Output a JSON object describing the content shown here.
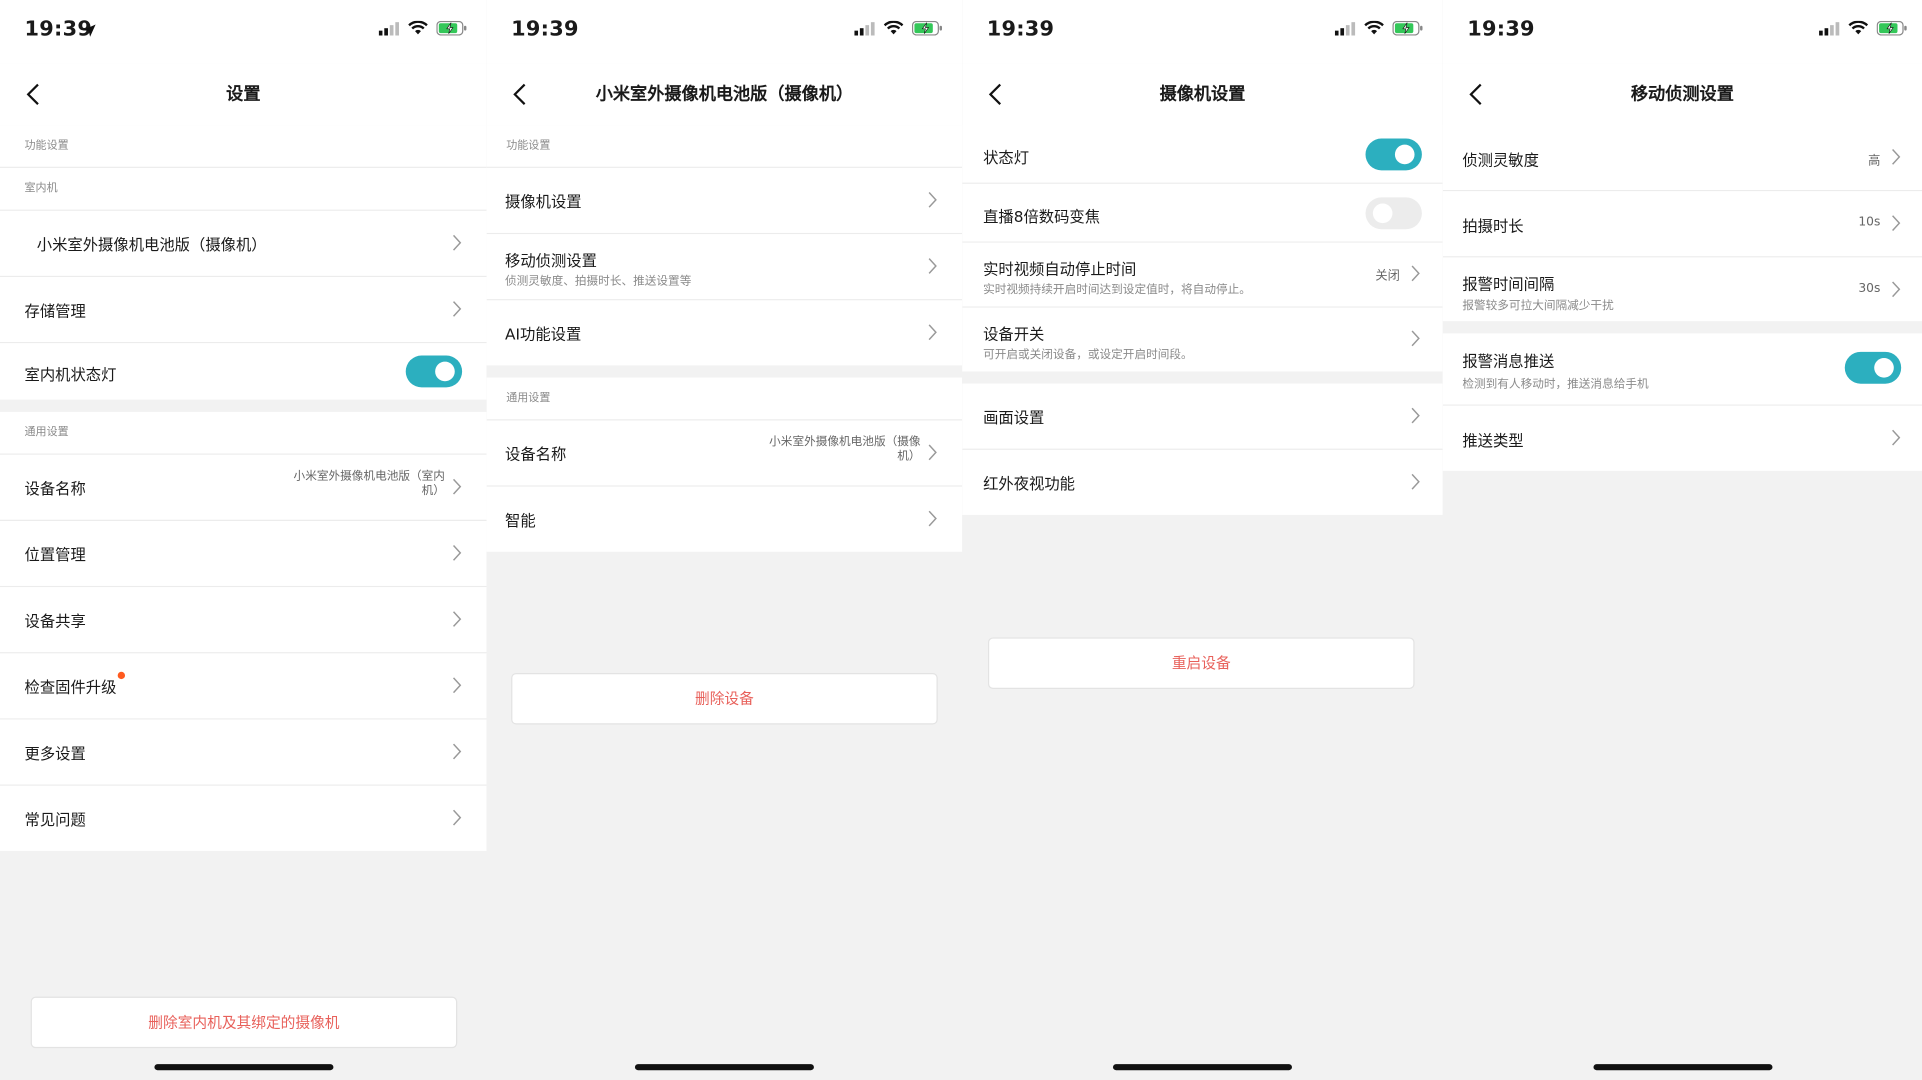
{
  "status": {
    "time": "19:39"
  },
  "screen1": {
    "title": "设置",
    "section_function": "功能设置",
    "section_indoor": "室内机",
    "camera_item": "小米室外摄像机电池版（摄像机）",
    "storage": "存储管理",
    "indoor_light": "室内机状态灯",
    "section_general": "通用设置",
    "device_name": "设备名称",
    "device_name_value_1": "小米室外摄像机电池版（室内",
    "device_name_value_2": "机）",
    "location": "位置管理",
    "share": "设备共享",
    "firmware": "检查固件升级",
    "more": "更多设置",
    "faq": "常见问题",
    "delete_button": "删除室内机及其绑定的摄像机"
  },
  "screen2": {
    "title": "小米室外摄像机电池版（摄像机）",
    "section_function": "功能设置",
    "camera_settings": "摄像机设置",
    "motion": "移动侦测设置",
    "motion_sub": "侦测灵敏度、拍摄时长、推送设置等",
    "ai": "AI功能设置",
    "section_general": "通用设置",
    "device_name": "设备名称",
    "device_name_value_1": "小米室外摄像机电池版（摄像",
    "device_name_value_2": "机）",
    "smart": "智能",
    "delete_button": "删除设备"
  },
  "screen3": {
    "title": "摄像机设置",
    "status_light": "状态灯",
    "zoom": "直播8倍数码变焦",
    "auto_stop": "实时视频自动停止时间",
    "auto_stop_sub": "实时视频持续开启时间达到设定值时，将自动停止。",
    "auto_stop_value": "关闭",
    "power": "设备开关",
    "power_sub": "可开启或关闭设备，或设定开启时间段。",
    "image": "画面设置",
    "night": "红外夜视功能",
    "restart_button": "重启设备"
  },
  "screen4": {
    "title": "移动侦测设置",
    "sensitivity": "侦测灵敏度",
    "sensitivity_value": "高",
    "duration": "拍摄时长",
    "duration_value": "10s",
    "interval": "报警时间间隔",
    "interval_sub": "报警较多可拉大间隔减少干扰",
    "interval_value": "30s",
    "push": "报警消息推送",
    "push_sub": "检测到有人移动时，推送消息给手机",
    "push_type": "推送类型"
  },
  "toggles": {
    "indoor_light": true,
    "status_light": true,
    "zoom": false,
    "push": true
  },
  "colors": {
    "accent": "#2cafbf",
    "danger": "#e8615b",
    "badge": "#ff5a1f",
    "battery": "#34c759"
  },
  "icons": [
    "location-arrow-icon",
    "cellular-signal-icon",
    "wifi-icon",
    "battery-charging-icon",
    "back-chevron-icon",
    "chevron-right-icon"
  ]
}
